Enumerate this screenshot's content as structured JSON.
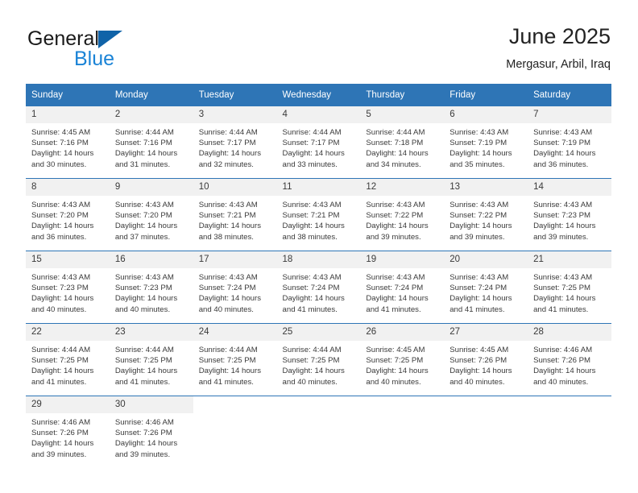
{
  "brand": {
    "line1": "General",
    "line2": "Blue",
    "logo_icon": "triangle-logo-icon",
    "colors": {
      "blue": "#1a83d6",
      "triangle": "#1063a8",
      "dark": "#1a1a1a"
    }
  },
  "header": {
    "title": "June 2025",
    "subtitle": "Mergasur, Arbil, Iraq"
  },
  "theme": {
    "header_blue": "#2e75b6",
    "daynum_gray": "#f1f1f1",
    "text": "#3a3a3a"
  },
  "calendar": {
    "weekday_headers": [
      "Sunday",
      "Monday",
      "Tuesday",
      "Wednesday",
      "Thursday",
      "Friday",
      "Saturday"
    ],
    "weeks": [
      [
        {
          "day": "1",
          "sunrise": "Sunrise: 4:45 AM",
          "sunset": "Sunset: 7:16 PM",
          "daylight": "Daylight: 14 hours and 30 minutes."
        },
        {
          "day": "2",
          "sunrise": "Sunrise: 4:44 AM",
          "sunset": "Sunset: 7:16 PM",
          "daylight": "Daylight: 14 hours and 31 minutes."
        },
        {
          "day": "3",
          "sunrise": "Sunrise: 4:44 AM",
          "sunset": "Sunset: 7:17 PM",
          "daylight": "Daylight: 14 hours and 32 minutes."
        },
        {
          "day": "4",
          "sunrise": "Sunrise: 4:44 AM",
          "sunset": "Sunset: 7:17 PM",
          "daylight": "Daylight: 14 hours and 33 minutes."
        },
        {
          "day": "5",
          "sunrise": "Sunrise: 4:44 AM",
          "sunset": "Sunset: 7:18 PM",
          "daylight": "Daylight: 14 hours and 34 minutes."
        },
        {
          "day": "6",
          "sunrise": "Sunrise: 4:43 AM",
          "sunset": "Sunset: 7:19 PM",
          "daylight": "Daylight: 14 hours and 35 minutes."
        },
        {
          "day": "7",
          "sunrise": "Sunrise: 4:43 AM",
          "sunset": "Sunset: 7:19 PM",
          "daylight": "Daylight: 14 hours and 36 minutes."
        }
      ],
      [
        {
          "day": "8",
          "sunrise": "Sunrise: 4:43 AM",
          "sunset": "Sunset: 7:20 PM",
          "daylight": "Daylight: 14 hours and 36 minutes."
        },
        {
          "day": "9",
          "sunrise": "Sunrise: 4:43 AM",
          "sunset": "Sunset: 7:20 PM",
          "daylight": "Daylight: 14 hours and 37 minutes."
        },
        {
          "day": "10",
          "sunrise": "Sunrise: 4:43 AM",
          "sunset": "Sunset: 7:21 PM",
          "daylight": "Daylight: 14 hours and 38 minutes."
        },
        {
          "day": "11",
          "sunrise": "Sunrise: 4:43 AM",
          "sunset": "Sunset: 7:21 PM",
          "daylight": "Daylight: 14 hours and 38 minutes."
        },
        {
          "day": "12",
          "sunrise": "Sunrise: 4:43 AM",
          "sunset": "Sunset: 7:22 PM",
          "daylight": "Daylight: 14 hours and 39 minutes."
        },
        {
          "day": "13",
          "sunrise": "Sunrise: 4:43 AM",
          "sunset": "Sunset: 7:22 PM",
          "daylight": "Daylight: 14 hours and 39 minutes."
        },
        {
          "day": "14",
          "sunrise": "Sunrise: 4:43 AM",
          "sunset": "Sunset: 7:23 PM",
          "daylight": "Daylight: 14 hours and 39 minutes."
        }
      ],
      [
        {
          "day": "15",
          "sunrise": "Sunrise: 4:43 AM",
          "sunset": "Sunset: 7:23 PM",
          "daylight": "Daylight: 14 hours and 40 minutes."
        },
        {
          "day": "16",
          "sunrise": "Sunrise: 4:43 AM",
          "sunset": "Sunset: 7:23 PM",
          "daylight": "Daylight: 14 hours and 40 minutes."
        },
        {
          "day": "17",
          "sunrise": "Sunrise: 4:43 AM",
          "sunset": "Sunset: 7:24 PM",
          "daylight": "Daylight: 14 hours and 40 minutes."
        },
        {
          "day": "18",
          "sunrise": "Sunrise: 4:43 AM",
          "sunset": "Sunset: 7:24 PM",
          "daylight": "Daylight: 14 hours and 41 minutes."
        },
        {
          "day": "19",
          "sunrise": "Sunrise: 4:43 AM",
          "sunset": "Sunset: 7:24 PM",
          "daylight": "Daylight: 14 hours and 41 minutes."
        },
        {
          "day": "20",
          "sunrise": "Sunrise: 4:43 AM",
          "sunset": "Sunset: 7:24 PM",
          "daylight": "Daylight: 14 hours and 41 minutes."
        },
        {
          "day": "21",
          "sunrise": "Sunrise: 4:43 AM",
          "sunset": "Sunset: 7:25 PM",
          "daylight": "Daylight: 14 hours and 41 minutes."
        }
      ],
      [
        {
          "day": "22",
          "sunrise": "Sunrise: 4:44 AM",
          "sunset": "Sunset: 7:25 PM",
          "daylight": "Daylight: 14 hours and 41 minutes."
        },
        {
          "day": "23",
          "sunrise": "Sunrise: 4:44 AM",
          "sunset": "Sunset: 7:25 PM",
          "daylight": "Daylight: 14 hours and 41 minutes."
        },
        {
          "day": "24",
          "sunrise": "Sunrise: 4:44 AM",
          "sunset": "Sunset: 7:25 PM",
          "daylight": "Daylight: 14 hours and 41 minutes."
        },
        {
          "day": "25",
          "sunrise": "Sunrise: 4:44 AM",
          "sunset": "Sunset: 7:25 PM",
          "daylight": "Daylight: 14 hours and 40 minutes."
        },
        {
          "day": "26",
          "sunrise": "Sunrise: 4:45 AM",
          "sunset": "Sunset: 7:25 PM",
          "daylight": "Daylight: 14 hours and 40 minutes."
        },
        {
          "day": "27",
          "sunrise": "Sunrise: 4:45 AM",
          "sunset": "Sunset: 7:26 PM",
          "daylight": "Daylight: 14 hours and 40 minutes."
        },
        {
          "day": "28",
          "sunrise": "Sunrise: 4:46 AM",
          "sunset": "Sunset: 7:26 PM",
          "daylight": "Daylight: 14 hours and 40 minutes."
        }
      ],
      [
        {
          "day": "29",
          "sunrise": "Sunrise: 4:46 AM",
          "sunset": "Sunset: 7:26 PM",
          "daylight": "Daylight: 14 hours and 39 minutes."
        },
        {
          "day": "30",
          "sunrise": "Sunrise: 4:46 AM",
          "sunset": "Sunset: 7:26 PM",
          "daylight": "Daylight: 14 hours and 39 minutes."
        },
        {
          "day": "",
          "sunrise": "",
          "sunset": "",
          "daylight": ""
        },
        {
          "day": "",
          "sunrise": "",
          "sunset": "",
          "daylight": ""
        },
        {
          "day": "",
          "sunrise": "",
          "sunset": "",
          "daylight": ""
        },
        {
          "day": "",
          "sunrise": "",
          "sunset": "",
          "daylight": ""
        },
        {
          "day": "",
          "sunrise": "",
          "sunset": "",
          "daylight": ""
        }
      ]
    ]
  }
}
